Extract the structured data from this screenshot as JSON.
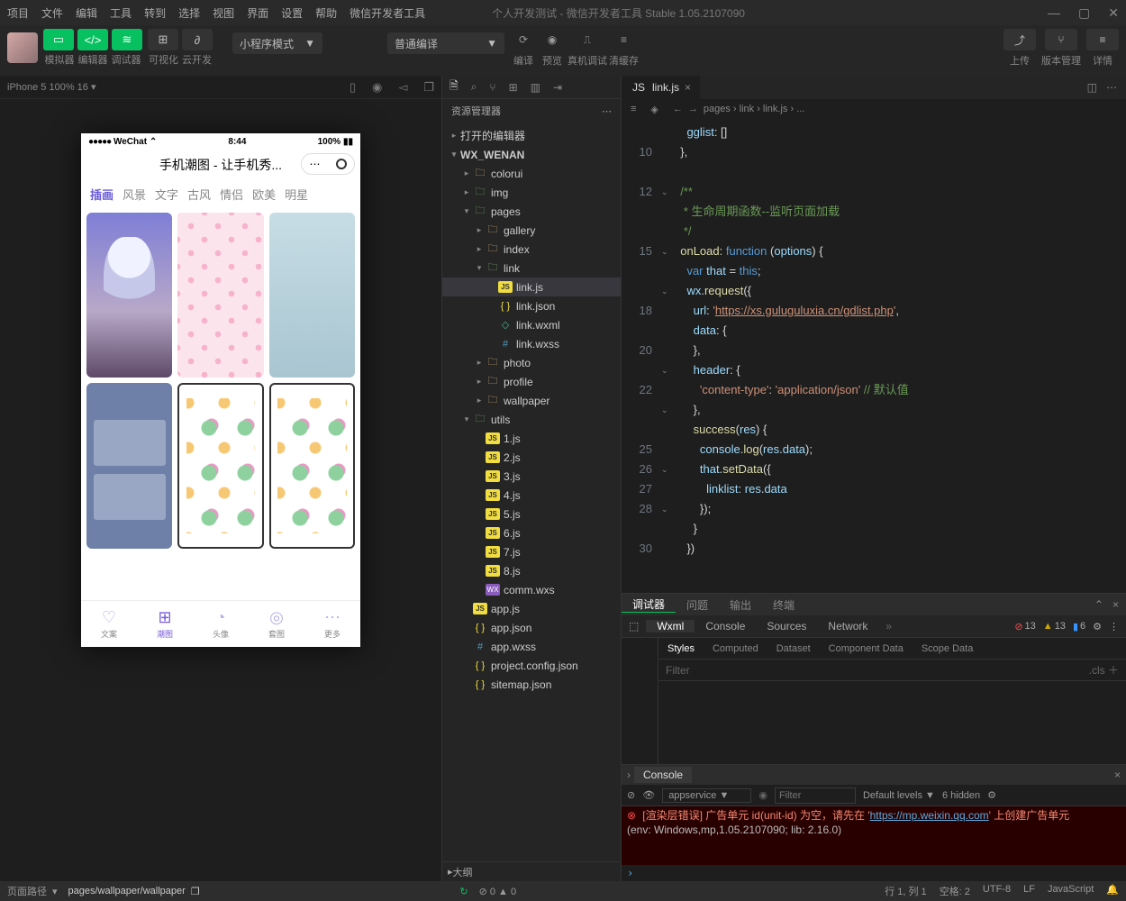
{
  "menubar": [
    "项目",
    "文件",
    "编辑",
    "工具",
    "转到",
    "选择",
    "视图",
    "界面",
    "设置",
    "帮助",
    "微信开发者工具"
  ],
  "window_title": "个人开发测试 - 微信开发者工具 Stable 1.05.2107090",
  "toolbar": {
    "groups": [
      {
        "labels": [
          "模拟器",
          "编辑器",
          "调试器"
        ]
      },
      {
        "labels": [
          "可视化",
          "云开发"
        ]
      }
    ],
    "compile_mode": "小程序模式",
    "build_mode": "普通编译",
    "mid": [
      {
        "label": "编译"
      },
      {
        "label": "预览"
      },
      {
        "label": "真机调试"
      },
      {
        "label": "清缓存"
      }
    ],
    "right": [
      {
        "label": "上传"
      },
      {
        "label": "版本管理"
      },
      {
        "label": "详情"
      }
    ]
  },
  "simulator": {
    "device": "iPhone 5 100% 16",
    "status_time": "8:44",
    "status_batt": "100%",
    "wechat": "WeChat",
    "page_title": "手机潮图 - 让手机秀...",
    "tabs": [
      "插画",
      "风景",
      "文字",
      "古风",
      "情侣",
      "欧美",
      "明星"
    ],
    "tabbar": [
      {
        "label": "文案"
      },
      {
        "label": "潮图"
      },
      {
        "label": "头像"
      },
      {
        "label": "套图"
      },
      {
        "label": "更多"
      }
    ]
  },
  "explorer": {
    "title": "资源管理器",
    "sections": [
      {
        "label": "打开的编辑器",
        "indent": 0,
        "chev": "▸"
      },
      {
        "label": "WX_WENAN",
        "indent": 0,
        "chev": "▾",
        "bold": true
      }
    ],
    "tree": [
      {
        "l": "colorui",
        "t": "folder",
        "i": 1,
        "c": "▸"
      },
      {
        "l": "img",
        "t": "folder",
        "i": 1,
        "c": "▸",
        "open": true
      },
      {
        "l": "pages",
        "t": "folder",
        "i": 1,
        "c": "▾",
        "open": true
      },
      {
        "l": "gallery",
        "t": "folder",
        "i": 2,
        "c": "▸"
      },
      {
        "l": "index",
        "t": "folder",
        "i": 2,
        "c": "▸"
      },
      {
        "l": "link",
        "t": "folder",
        "i": 2,
        "c": "▾",
        "open": true
      },
      {
        "l": "link.js",
        "t": "js",
        "i": 3,
        "sel": true
      },
      {
        "l": "link.json",
        "t": "json",
        "i": 3
      },
      {
        "l": "link.wxml",
        "t": "wxml",
        "i": 3
      },
      {
        "l": "link.wxss",
        "t": "wxss",
        "i": 3
      },
      {
        "l": "photo",
        "t": "folder",
        "i": 2,
        "c": "▸"
      },
      {
        "l": "profile",
        "t": "folder",
        "i": 2,
        "c": "▸"
      },
      {
        "l": "wallpaper",
        "t": "folder",
        "i": 2,
        "c": "▸"
      },
      {
        "l": "utils",
        "t": "folder",
        "i": 1,
        "c": "▾",
        "open": true
      },
      {
        "l": "1.js",
        "t": "js",
        "i": 2
      },
      {
        "l": "2.js",
        "t": "js",
        "i": 2
      },
      {
        "l": "3.js",
        "t": "js",
        "i": 2
      },
      {
        "l": "4.js",
        "t": "js",
        "i": 2
      },
      {
        "l": "5.js",
        "t": "js",
        "i": 2
      },
      {
        "l": "6.js",
        "t": "js",
        "i": 2
      },
      {
        "l": "7.js",
        "t": "js",
        "i": 2
      },
      {
        "l": "8.js",
        "t": "js",
        "i": 2
      },
      {
        "l": "comm.wxs",
        "t": "wxs",
        "i": 2
      },
      {
        "l": "app.js",
        "t": "js",
        "i": 1
      },
      {
        "l": "app.json",
        "t": "json",
        "i": 1
      },
      {
        "l": "app.wxss",
        "t": "wxss",
        "i": 1
      },
      {
        "l": "project.config.json",
        "t": "json",
        "i": 1
      },
      {
        "l": "sitemap.json",
        "t": "json",
        "i": 1
      }
    ],
    "outline": "大纲"
  },
  "editor": {
    "tab_name": "link.js",
    "breadcrumbs": [
      "pages",
      "link",
      "link.js",
      "..."
    ],
    "lines": [
      {
        "n": "",
        "h": "    <span class='tok-v'>gglist</span><span class='tok-p'>: []</span>"
      },
      {
        "n": "10",
        "h": "  <span class='tok-p'>},</span>"
      },
      {
        "n": "",
        "h": ""
      },
      {
        "n": "12",
        "h": "  <span class='tok-c'>/**</span>"
      },
      {
        "n": "",
        "h": "  <span class='tok-c'> * 生命周期函数--监听页面加载</span>"
      },
      {
        "n": "",
        "h": "  <span class='tok-c'> */</span>"
      },
      {
        "n": "15",
        "h": "  <span class='tok-f'>onLoad</span><span class='tok-p'>: </span><span class='tok-o'>function</span><span class='tok-p'> (</span><span class='tok-v'>options</span><span class='tok-p'>) {</span>"
      },
      {
        "n": "",
        "h": "    <span class='tok-o'>var</span> <span class='tok-v'>that</span> <span class='tok-p'>=</span> <span class='tok-o'>this</span><span class='tok-p'>;</span>"
      },
      {
        "n": "",
        "h": "    <span class='tok-v'>wx</span><span class='tok-p'>.</span><span class='tok-f'>request</span><span class='tok-p'>({</span>"
      },
      {
        "n": "18",
        "h": "      <span class='tok-v'>url</span><span class='tok-p'>: </span><span class='tok-s'>'</span><span class='tok-u'>https://xs.guluguluxia.cn/gdlist.php</span><span class='tok-s'>'</span><span class='tok-p'>,</span>"
      },
      {
        "n": "",
        "h": "      <span class='tok-v'>data</span><span class='tok-p'>: {</span>"
      },
      {
        "n": "20",
        "h": "      <span class='tok-p'>},</span>"
      },
      {
        "n": "",
        "h": "      <span class='tok-v'>header</span><span class='tok-p'>: {</span>"
      },
      {
        "n": "22",
        "h": "        <span class='tok-s'>'content-type'</span><span class='tok-p'>: </span><span class='tok-s'>'application/json'</span> <span class='tok-c'>// 默认值</span>"
      },
      {
        "n": "",
        "h": "      <span class='tok-p'>},</span>"
      },
      {
        "n": "",
        "h": "      <span class='tok-f'>success</span><span class='tok-p'>(</span><span class='tok-v'>res</span><span class='tok-p'>) {</span>"
      },
      {
        "n": "25",
        "h": "        <span class='tok-v'>console</span><span class='tok-p'>.</span><span class='tok-f'>log</span><span class='tok-p'>(</span><span class='tok-v'>res</span><span class='tok-p'>.</span><span class='tok-v'>data</span><span class='tok-p'>);</span>"
      },
      {
        "n": "26",
        "h": "        <span class='tok-v'>that</span><span class='tok-p'>.</span><span class='tok-f'>setData</span><span class='tok-p'>({</span>"
      },
      {
        "n": "27",
        "h": "          <span class='tok-v'>linklist</span><span class='tok-p'>: </span><span class='tok-v'>res</span><span class='tok-p'>.</span><span class='tok-v'>data</span>"
      },
      {
        "n": "28",
        "h": "        <span class='tok-p'>});</span>"
      },
      {
        "n": "",
        "h": "      <span class='tok-p'>}</span>"
      },
      {
        "n": "30",
        "h": "    <span class='tok-p'>})</span>"
      }
    ],
    "folds": {
      "3": "⌄",
      "6": "⌄",
      "8": "⌄",
      "12": "⌄",
      "14": "⌄",
      "17": "⌄",
      "19": "⌄"
    }
  },
  "debugger": {
    "tabs": [
      "调试器",
      "问题",
      "输出",
      "终端"
    ],
    "devtabs": [
      "Wxml",
      "Console",
      "Sources",
      "Network"
    ],
    "badges": {
      "errors": 13,
      "warnings": 13,
      "info": 6
    },
    "style_tabs": [
      "Styles",
      "Computed",
      "Dataset",
      "Component Data",
      "Scope Data"
    ],
    "style_filter": "Filter",
    "style_cls": ".cls",
    "console": {
      "header": "Console",
      "context": "appservice",
      "filter_placeholder": "Filter",
      "levels": "Default levels",
      "hidden": "6 hidden",
      "err1": "[渲染层错误] 广告单元 id(unit-id) 为空，请先在 '",
      "err_link": "https://mp.weixin.qq.com",
      "err2": "' 上创建广告单元",
      "env": "(env: Windows,mp,1.05.2107090; lib: 2.16.0)"
    }
  },
  "statusbar": {
    "left_label": "页面路径",
    "path": "pages/wallpaper/wallpaper",
    "icons_info": "0  0",
    "right": [
      "行 1, 列 1",
      "空格: 2",
      "UTF-8",
      "LF",
      "JavaScript"
    ]
  }
}
